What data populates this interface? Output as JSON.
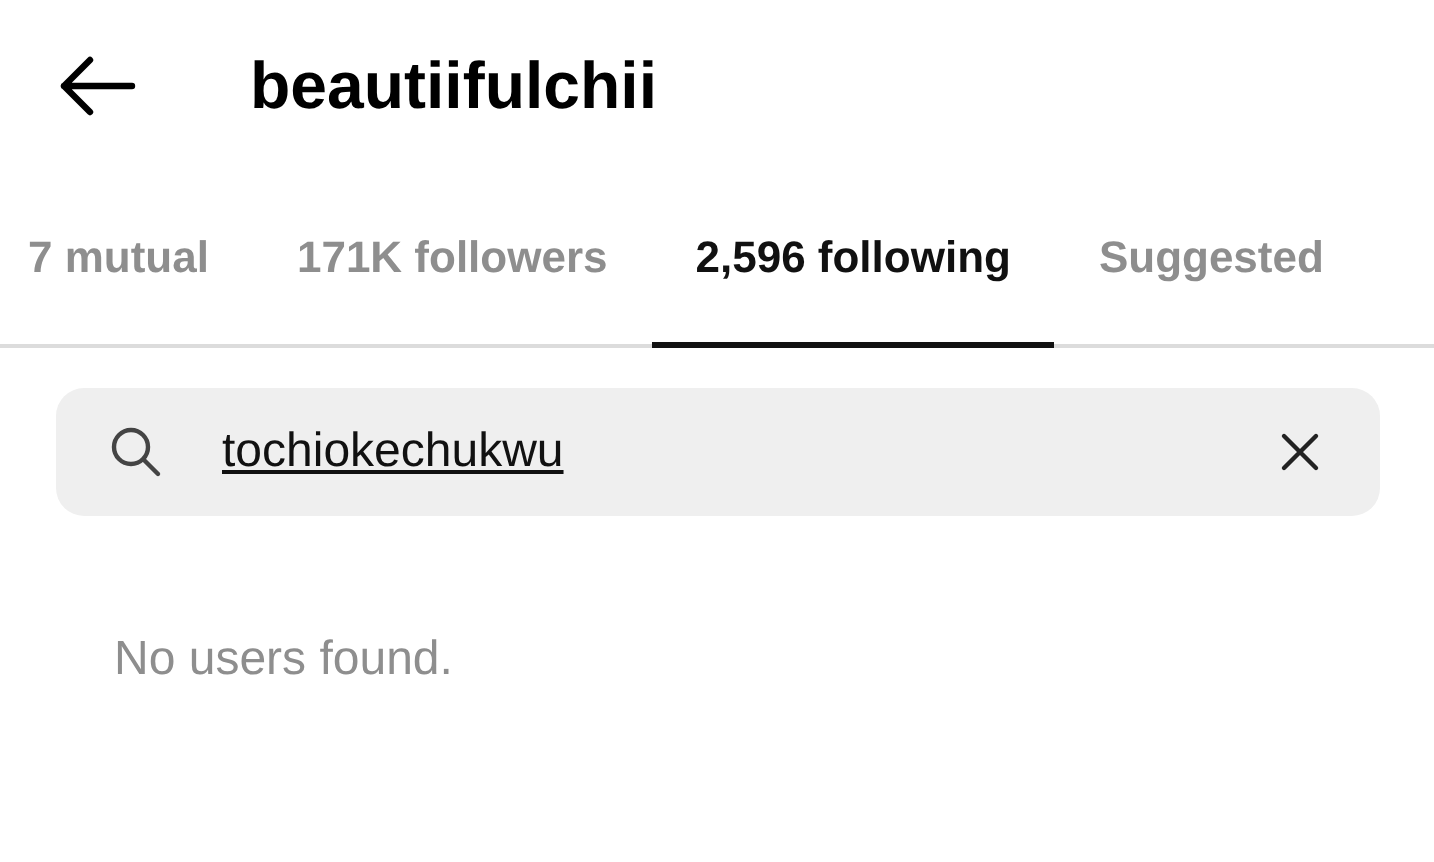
{
  "header": {
    "title": "beautiifulchii"
  },
  "tabs": [
    {
      "label": "7 mutual",
      "selected": false
    },
    {
      "label": "171K followers",
      "selected": false
    },
    {
      "label": "2,596 following",
      "selected": true
    },
    {
      "label": "Suggested",
      "selected": false
    }
  ],
  "search": {
    "value": "tochiokechukwu"
  },
  "message": "No users found."
}
